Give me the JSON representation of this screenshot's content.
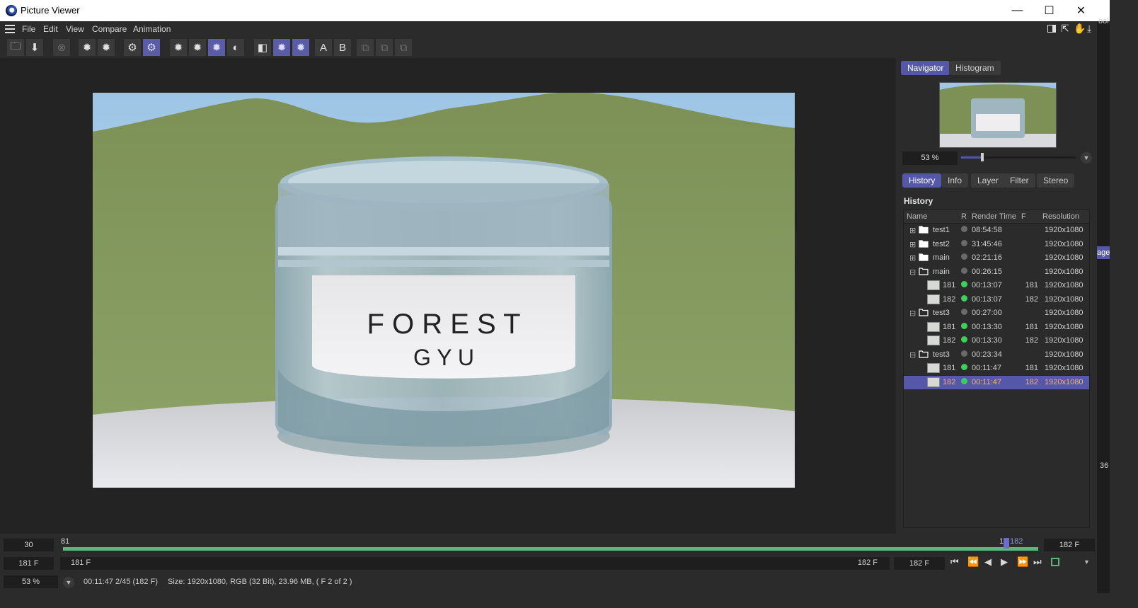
{
  "window": {
    "title": "Picture Viewer",
    "minimize": "—",
    "maximize": "☐",
    "close": "✕"
  },
  "menu": {
    "file": "File",
    "edit": "Edit",
    "view": "View",
    "compare": "Compare",
    "animation": "Animation"
  },
  "toolbar": {
    "a_label": "A",
    "b_label": "B"
  },
  "render": {
    "brand_line1": "F O R E S T",
    "brand_line2": "G Y U"
  },
  "panel": {
    "tabs_top": [
      "Navigator",
      "Histogram"
    ],
    "zoom": "53 %",
    "zoom_slider_fraction": 0.17,
    "tabs_mid": [
      "History",
      "Info",
      "Layer",
      "Filter",
      "Stereo"
    ],
    "history_title": "History",
    "columns": {
      "name": "Name",
      "r": "R",
      "render_time": "Render Time",
      "f": "F",
      "resolution": "Resolution"
    },
    "rows": [
      {
        "kind": "folder",
        "expand": "⊞",
        "name": "test1",
        "status": "gray",
        "time": "08:54:58",
        "f": "",
        "res": "1920x1080"
      },
      {
        "kind": "folder",
        "expand": "⊞",
        "name": "test2",
        "status": "gray",
        "time": "31:45:46",
        "f": "",
        "res": "1920x1080"
      },
      {
        "kind": "folder",
        "expand": "⊞",
        "name": "main",
        "status": "gray",
        "time": "02:21:16",
        "f": "",
        "res": "1920x1080"
      },
      {
        "kind": "folder-open",
        "expand": "⊟",
        "name": "main",
        "status": "gray",
        "time": "00:26:15",
        "f": "",
        "res": "1920x1080"
      },
      {
        "kind": "frame",
        "expand": "",
        "name": "181",
        "status": "green",
        "time": "00:13:07",
        "f": "181",
        "res": "1920x1080"
      },
      {
        "kind": "frame",
        "expand": "",
        "name": "182",
        "status": "green",
        "time": "00:13:07",
        "f": "182",
        "res": "1920x1080"
      },
      {
        "kind": "folder-open",
        "expand": "⊟",
        "name": "test3",
        "status": "gray",
        "time": "00:27:00",
        "f": "",
        "res": "1920x1080"
      },
      {
        "kind": "frame",
        "expand": "",
        "name": "181",
        "status": "green",
        "time": "00:13:30",
        "f": "181",
        "res": "1920x1080"
      },
      {
        "kind": "frame",
        "expand": "",
        "name": "182",
        "status": "green",
        "time": "00:13:30",
        "f": "182",
        "res": "1920x1080"
      },
      {
        "kind": "folder-open",
        "expand": "⊟",
        "name": "test3",
        "status": "gray",
        "time": "00:23:34",
        "f": "",
        "res": "1920x1080"
      },
      {
        "kind": "frame",
        "expand": "",
        "name": "181",
        "status": "green",
        "time": "00:11:47",
        "f": "181",
        "res": "1920x1080"
      },
      {
        "kind": "frame",
        "expand": "",
        "name": "182",
        "status": "green",
        "time": "00:11:47",
        "f": "182",
        "res": "1920x1080",
        "selected": true
      }
    ]
  },
  "timeline": {
    "fps": "30",
    "start_tick": "81",
    "end_tick_label": "182",
    "end_tick_partial": "1",
    "end_frame": "182 F",
    "current_frame": "181 F",
    "range_start": "181 F",
    "range_end": "182 F",
    "play_frame": "182 F"
  },
  "status": {
    "zoom": "53 %",
    "info": "00:11:47 2/45 (182 F)",
    "details": "Size: 1920x1080, RGB (32 Bit), 23.96 MB,  ( F 2 of 2 )"
  },
  "edge": {
    "top_text": "ool",
    "mid_text": "age",
    "low_text": "36"
  },
  "colors": {
    "accent": "#5558a8",
    "timeline_green": "#5cb87a",
    "status_green": "#3ccf5a",
    "selected_text": "#ffb060"
  }
}
